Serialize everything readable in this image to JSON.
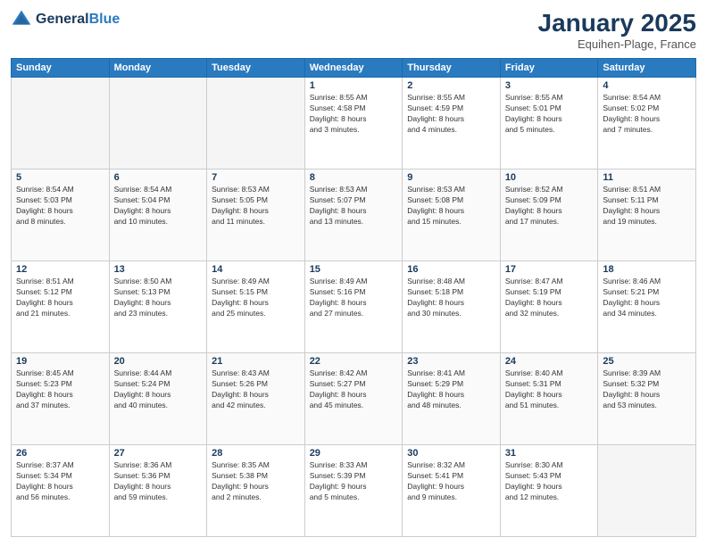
{
  "header": {
    "logo_line1": "General",
    "logo_line2": "Blue",
    "month": "January 2025",
    "location": "Equihen-Plage, France"
  },
  "weekdays": [
    "Sunday",
    "Monday",
    "Tuesday",
    "Wednesday",
    "Thursday",
    "Friday",
    "Saturday"
  ],
  "weeks": [
    [
      {
        "day": "",
        "info": ""
      },
      {
        "day": "",
        "info": ""
      },
      {
        "day": "",
        "info": ""
      },
      {
        "day": "1",
        "info": "Sunrise: 8:55 AM\nSunset: 4:58 PM\nDaylight: 8 hours\nand 3 minutes."
      },
      {
        "day": "2",
        "info": "Sunrise: 8:55 AM\nSunset: 4:59 PM\nDaylight: 8 hours\nand 4 minutes."
      },
      {
        "day": "3",
        "info": "Sunrise: 8:55 AM\nSunset: 5:01 PM\nDaylight: 8 hours\nand 5 minutes."
      },
      {
        "day": "4",
        "info": "Sunrise: 8:54 AM\nSunset: 5:02 PM\nDaylight: 8 hours\nand 7 minutes."
      }
    ],
    [
      {
        "day": "5",
        "info": "Sunrise: 8:54 AM\nSunset: 5:03 PM\nDaylight: 8 hours\nand 8 minutes."
      },
      {
        "day": "6",
        "info": "Sunrise: 8:54 AM\nSunset: 5:04 PM\nDaylight: 8 hours\nand 10 minutes."
      },
      {
        "day": "7",
        "info": "Sunrise: 8:53 AM\nSunset: 5:05 PM\nDaylight: 8 hours\nand 11 minutes."
      },
      {
        "day": "8",
        "info": "Sunrise: 8:53 AM\nSunset: 5:07 PM\nDaylight: 8 hours\nand 13 minutes."
      },
      {
        "day": "9",
        "info": "Sunrise: 8:53 AM\nSunset: 5:08 PM\nDaylight: 8 hours\nand 15 minutes."
      },
      {
        "day": "10",
        "info": "Sunrise: 8:52 AM\nSunset: 5:09 PM\nDaylight: 8 hours\nand 17 minutes."
      },
      {
        "day": "11",
        "info": "Sunrise: 8:51 AM\nSunset: 5:11 PM\nDaylight: 8 hours\nand 19 minutes."
      }
    ],
    [
      {
        "day": "12",
        "info": "Sunrise: 8:51 AM\nSunset: 5:12 PM\nDaylight: 8 hours\nand 21 minutes."
      },
      {
        "day": "13",
        "info": "Sunrise: 8:50 AM\nSunset: 5:13 PM\nDaylight: 8 hours\nand 23 minutes."
      },
      {
        "day": "14",
        "info": "Sunrise: 8:49 AM\nSunset: 5:15 PM\nDaylight: 8 hours\nand 25 minutes."
      },
      {
        "day": "15",
        "info": "Sunrise: 8:49 AM\nSunset: 5:16 PM\nDaylight: 8 hours\nand 27 minutes."
      },
      {
        "day": "16",
        "info": "Sunrise: 8:48 AM\nSunset: 5:18 PM\nDaylight: 8 hours\nand 30 minutes."
      },
      {
        "day": "17",
        "info": "Sunrise: 8:47 AM\nSunset: 5:19 PM\nDaylight: 8 hours\nand 32 minutes."
      },
      {
        "day": "18",
        "info": "Sunrise: 8:46 AM\nSunset: 5:21 PM\nDaylight: 8 hours\nand 34 minutes."
      }
    ],
    [
      {
        "day": "19",
        "info": "Sunrise: 8:45 AM\nSunset: 5:23 PM\nDaylight: 8 hours\nand 37 minutes."
      },
      {
        "day": "20",
        "info": "Sunrise: 8:44 AM\nSunset: 5:24 PM\nDaylight: 8 hours\nand 40 minutes."
      },
      {
        "day": "21",
        "info": "Sunrise: 8:43 AM\nSunset: 5:26 PM\nDaylight: 8 hours\nand 42 minutes."
      },
      {
        "day": "22",
        "info": "Sunrise: 8:42 AM\nSunset: 5:27 PM\nDaylight: 8 hours\nand 45 minutes."
      },
      {
        "day": "23",
        "info": "Sunrise: 8:41 AM\nSunset: 5:29 PM\nDaylight: 8 hours\nand 48 minutes."
      },
      {
        "day": "24",
        "info": "Sunrise: 8:40 AM\nSunset: 5:31 PM\nDaylight: 8 hours\nand 51 minutes."
      },
      {
        "day": "25",
        "info": "Sunrise: 8:39 AM\nSunset: 5:32 PM\nDaylight: 8 hours\nand 53 minutes."
      }
    ],
    [
      {
        "day": "26",
        "info": "Sunrise: 8:37 AM\nSunset: 5:34 PM\nDaylight: 8 hours\nand 56 minutes."
      },
      {
        "day": "27",
        "info": "Sunrise: 8:36 AM\nSunset: 5:36 PM\nDaylight: 8 hours\nand 59 minutes."
      },
      {
        "day": "28",
        "info": "Sunrise: 8:35 AM\nSunset: 5:38 PM\nDaylight: 9 hours\nand 2 minutes."
      },
      {
        "day": "29",
        "info": "Sunrise: 8:33 AM\nSunset: 5:39 PM\nDaylight: 9 hours\nand 5 minutes."
      },
      {
        "day": "30",
        "info": "Sunrise: 8:32 AM\nSunset: 5:41 PM\nDaylight: 9 hours\nand 9 minutes."
      },
      {
        "day": "31",
        "info": "Sunrise: 8:30 AM\nSunset: 5:43 PM\nDaylight: 9 hours\nand 12 minutes."
      },
      {
        "day": "",
        "info": ""
      }
    ]
  ]
}
